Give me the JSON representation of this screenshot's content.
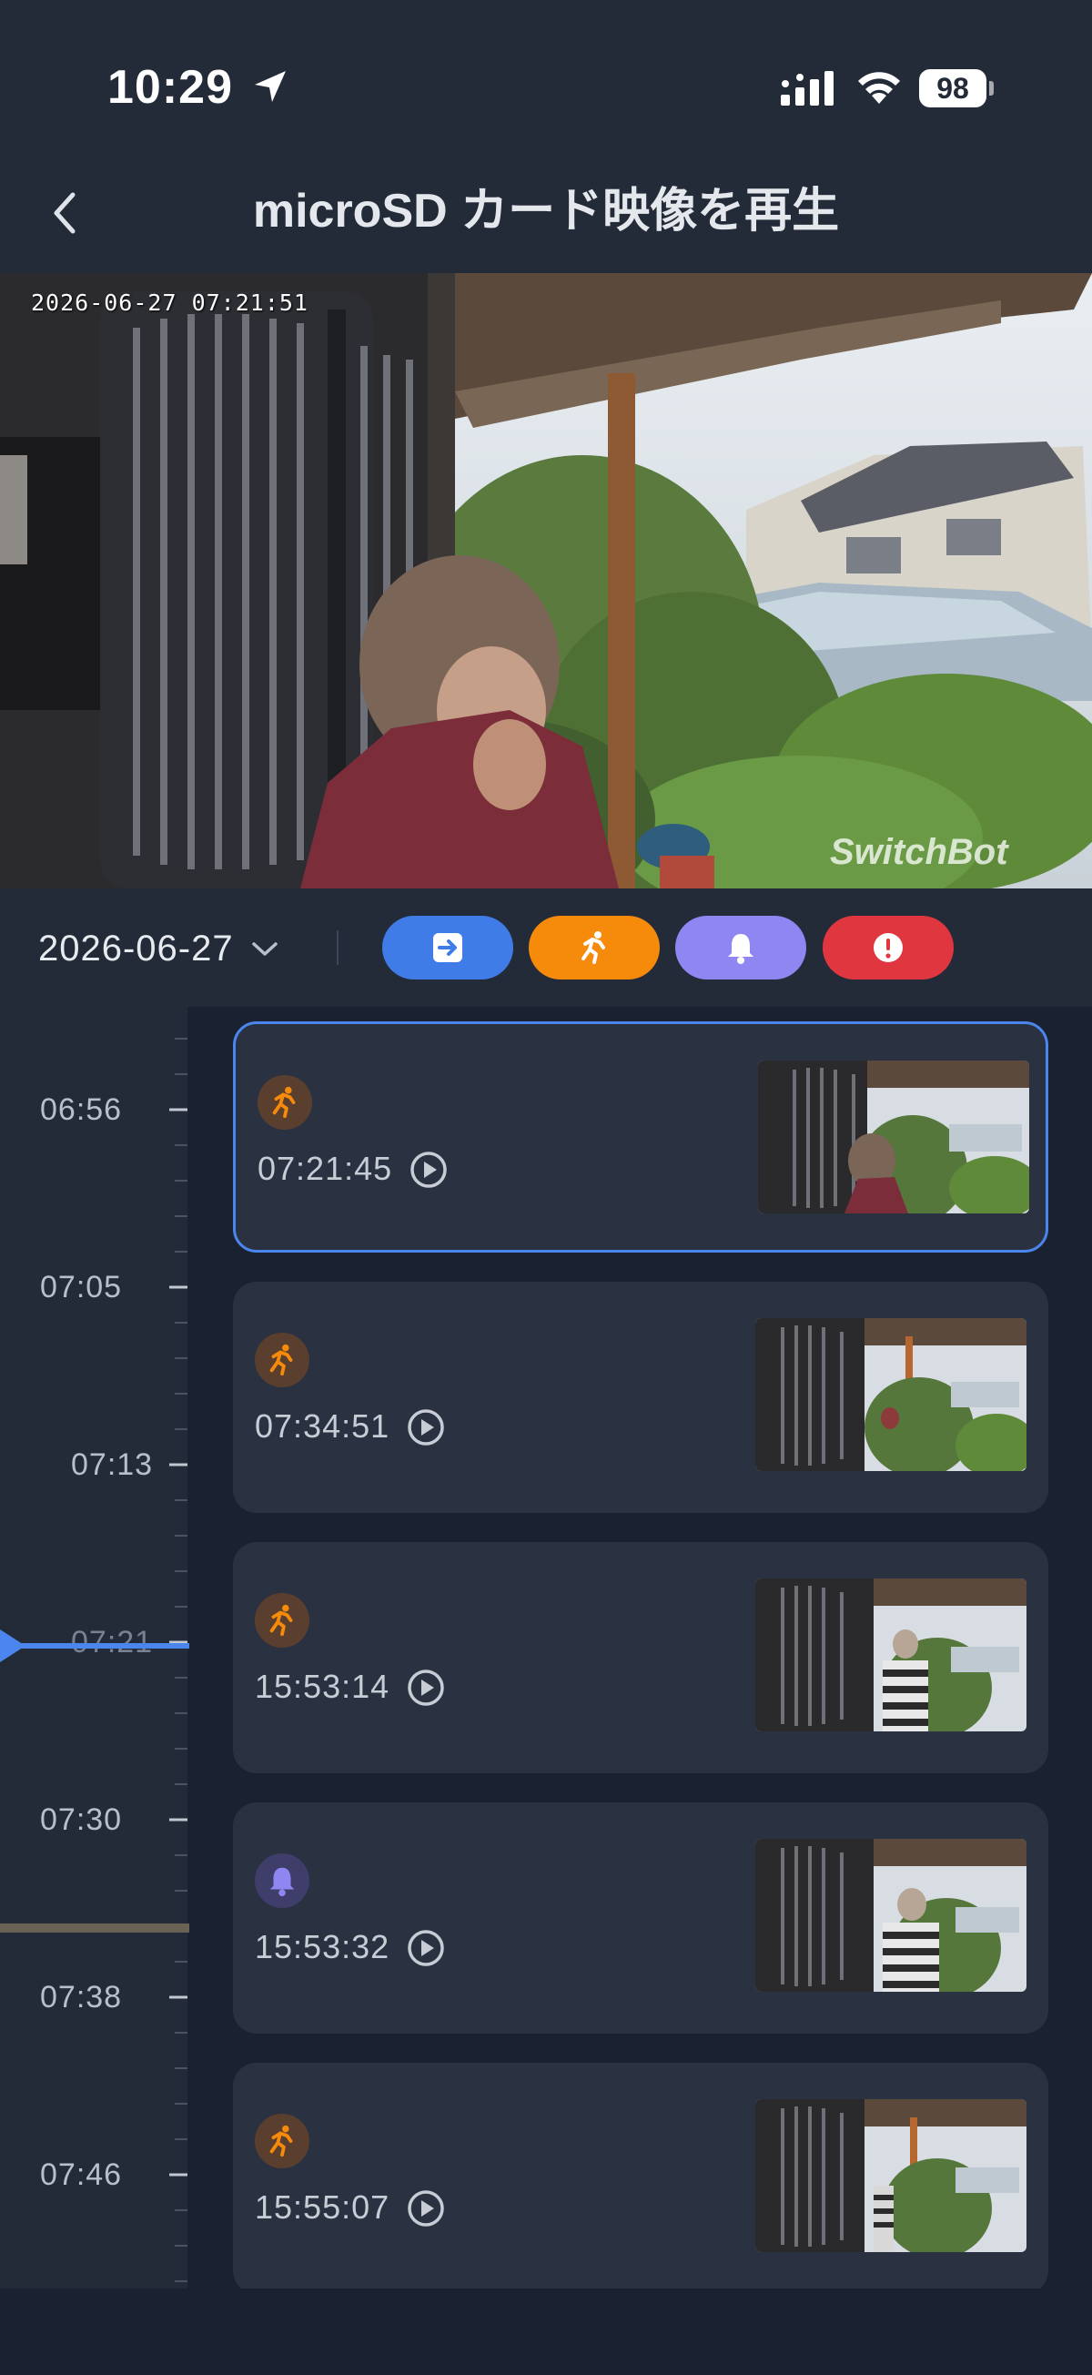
{
  "status_bar": {
    "time": "10:29",
    "battery": "98"
  },
  "header": {
    "title": "microSD カード映像を再生"
  },
  "video": {
    "timestamp": "2026-06-27 07:21:51",
    "watermark": "SwitchBot"
  },
  "filters": {
    "date": "2026-06-27",
    "chips": [
      {
        "name": "entry",
        "color": "#3f7ce8"
      },
      {
        "name": "motion",
        "color": "#f58a0b"
      },
      {
        "name": "doorbell",
        "color": "#8f86f2"
      },
      {
        "name": "alert",
        "color": "#e0363f"
      }
    ]
  },
  "timeline": {
    "labels": [
      "06:56",
      "07:05",
      "07:13",
      "07:21",
      "07:30",
      "07:38",
      "07:46"
    ],
    "current": "07:21"
  },
  "events": [
    {
      "type": "motion",
      "time": "07:21:45",
      "selected": true
    },
    {
      "type": "motion",
      "time": "07:34:51",
      "selected": false
    },
    {
      "type": "motion",
      "time": "15:53:14",
      "selected": false
    },
    {
      "type": "doorbell",
      "time": "15:53:32",
      "selected": false
    },
    {
      "type": "motion",
      "time": "15:55:07",
      "selected": false
    }
  ],
  "colors": {
    "background": "#232a38",
    "list_background": "#1a2130",
    "card": "#2a3242",
    "accent": "#4a86ee",
    "motion": "#f58a0b",
    "doorbell": "#8f86f2"
  }
}
